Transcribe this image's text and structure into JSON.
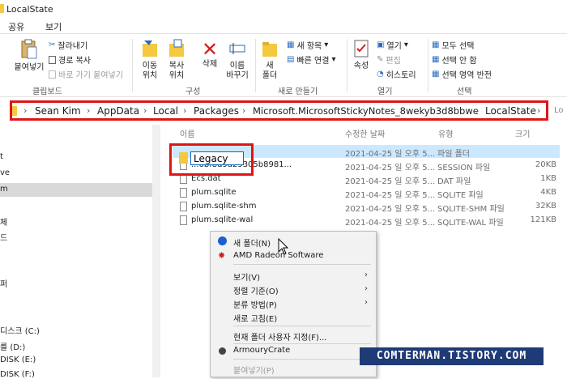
{
  "window": {
    "title": "LocalState"
  },
  "tabs": [
    "공유",
    "보기"
  ],
  "ribbon": {
    "clipboard": {
      "paste": "붙여넣기",
      "cut": "잘라내기",
      "copy_path": "경로 복사",
      "paste_shortcut": "바로 가기 붙여넣기",
      "label": "클립보드"
    },
    "organize": {
      "move_to": "이동\n위치",
      "copy_to": "복사\n위치",
      "delete": "삭제",
      "rename": "이름\n바꾸기",
      "label": "구성"
    },
    "new": {
      "new_folder": "새\n폴더",
      "new_item": "새 항목",
      "easy_access": "빠른 연결",
      "label": "새로 만들기"
    },
    "open": {
      "properties": "속성",
      "open": "열기",
      "edit": "편집",
      "history": "히스토리",
      "label": "열기"
    },
    "select": {
      "select_all": "모두 선택",
      "select_none": "선택 안 함",
      "invert": "선택 영역 반전",
      "label": "선택"
    }
  },
  "address": {
    "crumbs": [
      "Sean Kim",
      "AppData",
      "Local",
      "Packages",
      "Microsoft.MicrosoftStickyNotes_8wekyb3d8bbwe",
      "LocalState"
    ],
    "search_partial": "Lo"
  },
  "nav": {
    "items": [
      "t",
      "ve",
      "m",
      "",
      "체",
      "드",
      "",
      "",
      "",
      "퍼",
      "",
      "디스크 (C:)",
      "를 (D:)",
      "DISK (E:)",
      "DISK (F:)"
    ]
  },
  "columns": {
    "name": "이름",
    "date": "수정한 날짜",
    "type": "유형",
    "size": "크기"
  },
  "files": [
    {
      "name": "Legacy",
      "date": "2021-04-25 일 오후 5...",
      "type": "파일 폴더",
      "size": "",
      "selected": true,
      "kind": "folder"
    },
    {
      "name": "...6bf8d9a29305b8981...",
      "date": "2021-04-25 일 오후 5...",
      "type": "SESSION 파일",
      "size": "20KB",
      "selected": false,
      "kind": "file"
    },
    {
      "name": "Ecs.dat",
      "date": "2021-04-25 일 오후 5...",
      "type": "DAT 파일",
      "size": "1KB",
      "selected": false,
      "kind": "file"
    },
    {
      "name": "plum.sqlite",
      "date": "2021-04-25 일 오후 5...",
      "type": "SQLITE 파일",
      "size": "4KB",
      "selected": false,
      "kind": "file"
    },
    {
      "name": "plum.sqlite-shm",
      "date": "2021-04-25 일 오후 5...",
      "type": "SQLITE-SHM 파일",
      "size": "32KB",
      "selected": false,
      "kind": "file"
    },
    {
      "name": "plum.sqlite-wal",
      "date": "2021-04-25 일 오후 5...",
      "type": "SQLITE-WAL 파일",
      "size": "121KB",
      "selected": false,
      "kind": "file"
    }
  ],
  "rename_value": "Legacy",
  "context_menu": {
    "new_folder": "새 폴더(N)",
    "amd": "AMD Radeon Software",
    "view": "보기(V)",
    "sort": "정렬 기준(O)",
    "group": "분류 방법(P)",
    "refresh": "새로 고침(E)",
    "customize": "현재 폴더 사용자 지정(F)...",
    "armoury": "ArmouryCrate",
    "paste": "붙여넣기(P)"
  },
  "watermark": "COMTERMAN.TISTORY.COM",
  "colors": {
    "accent": "#0a64c8",
    "highlight": "#e01515",
    "selection": "#cce8ff",
    "folder": "#f5c842"
  }
}
